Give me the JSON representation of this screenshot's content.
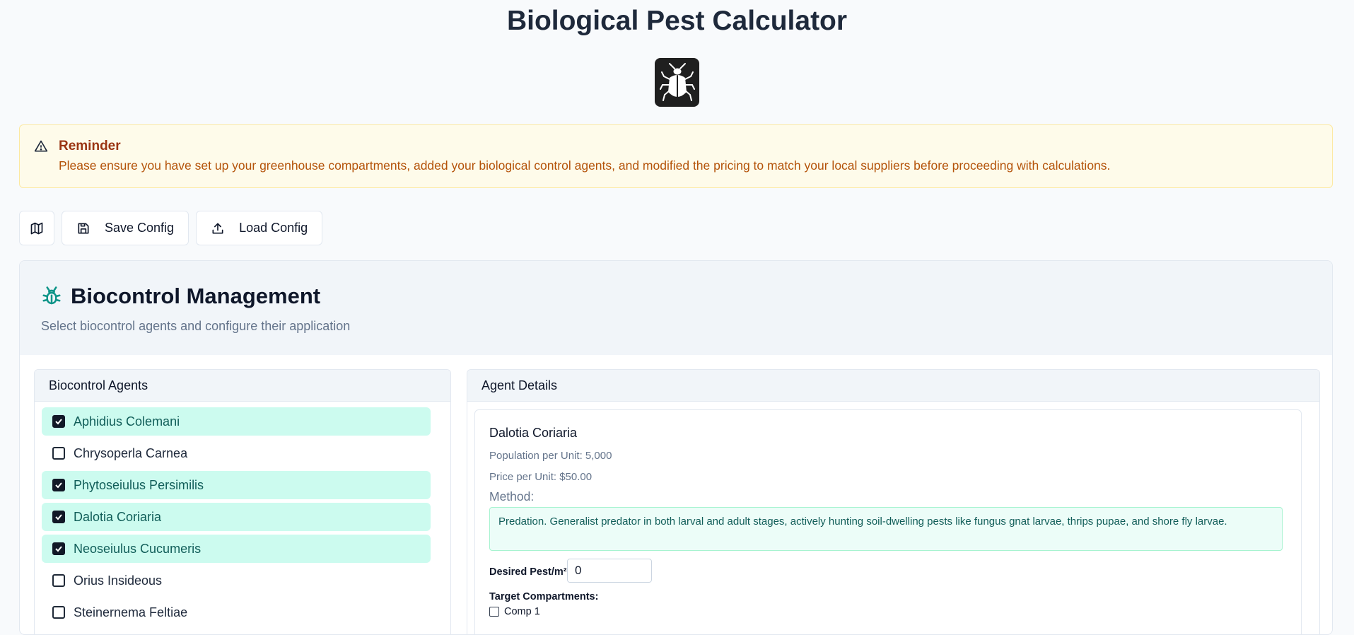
{
  "header": {
    "title": "Biological Pest Calculator",
    "logo_icon": "bug-icon"
  },
  "reminder": {
    "title": "Reminder",
    "text": "Please ensure you have set up your greenhouse compartments, added your biological control agents, and modified the pricing to match your local suppliers before proceeding with calculations.",
    "icon": "warning-triangle-icon"
  },
  "toolbar": {
    "map_icon": "map-icon",
    "save_label": "Save Config",
    "load_label": "Load Config"
  },
  "biocontrol": {
    "title": "Biocontrol Management",
    "subtitle": "Select biocontrol agents and configure their application",
    "agents_header": "Biocontrol Agents",
    "agents": [
      {
        "label": "Aphidius Colemani",
        "checked": true
      },
      {
        "label": "Chrysoperla Carnea",
        "checked": false
      },
      {
        "label": "Phytoseiulus Persimilis",
        "checked": true
      },
      {
        "label": "Dalotia Coriaria",
        "checked": true
      },
      {
        "label": "Neoseiulus Cucumeris",
        "checked": true
      },
      {
        "label": "Orius Insideous",
        "checked": false
      },
      {
        "label": "Steinernema Feltiae",
        "checked": false
      }
    ]
  },
  "details": {
    "header": "Agent Details",
    "name": "Dalotia Coriaria",
    "population": "Population per Unit: 5,000",
    "price": "Price per Unit: $50.00",
    "method_label": "Method:",
    "method": "Predation. Generalist predator in both larval and adult stages, actively hunting soil-dwelling pests like fungus gnat larvae, thrips pupae, and shore fly larvae.",
    "desired_label": "Desired Pest/m²:",
    "desired_value": "0",
    "target_label": "Target Compartments:",
    "compartments": [
      "Comp 1"
    ]
  },
  "colors": {
    "accent": "#0d9488",
    "checked_bg": "#ccfbef",
    "reminder_bg": "#fefbea"
  }
}
